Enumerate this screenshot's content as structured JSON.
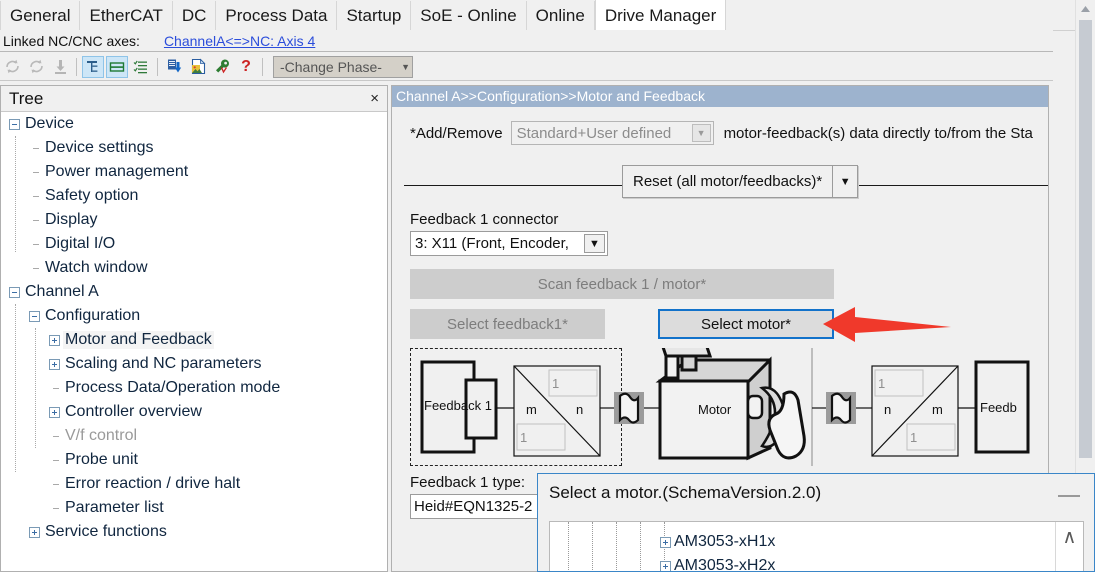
{
  "tabs": [
    {
      "label": "General",
      "active": false
    },
    {
      "label": "EtherCAT",
      "active": false
    },
    {
      "label": "DC",
      "active": false
    },
    {
      "label": "Process Data",
      "active": false
    },
    {
      "label": "Startup",
      "active": false
    },
    {
      "label": "SoE - Online",
      "active": false
    },
    {
      "label": "Online",
      "active": false
    },
    {
      "label": "Drive Manager",
      "active": true
    }
  ],
  "linked_bar": {
    "label": "Linked NC/CNC axes:",
    "link": "ChannelA<=>NC: Axis 4"
  },
  "toolbar": {
    "items": [
      {
        "name": "refresh-disabled-icon",
        "state": "disabled"
      },
      {
        "name": "reload-disabled-icon",
        "state": "disabled"
      },
      {
        "name": "download-disabled-icon",
        "state": "disabled"
      },
      {
        "name": "tree-view-icon",
        "state": "toggled-on"
      },
      {
        "name": "split-view-icon",
        "state": "toggled-on"
      },
      {
        "name": "list-view-icon",
        "state": "normal"
      },
      {
        "name": "save-to-device-icon",
        "state": "normal"
      },
      {
        "name": "export-icon",
        "state": "normal"
      },
      {
        "name": "wrench-icon",
        "state": "normal"
      },
      {
        "name": "help-icon",
        "state": "normal"
      }
    ],
    "phase_combo": "-Change Phase-"
  },
  "tree": {
    "title": "Tree",
    "close_label": "×",
    "nodes": [
      {
        "label": "Device",
        "depth": 0,
        "toggle": "minus",
        "dim": false,
        "selected": false
      },
      {
        "label": "Device settings",
        "depth": 1,
        "toggle": "leaf",
        "dim": false,
        "selected": false
      },
      {
        "label": "Power management",
        "depth": 1,
        "toggle": "leaf",
        "dim": false,
        "selected": false
      },
      {
        "label": "Safety option",
        "depth": 1,
        "toggle": "leaf",
        "dim": false,
        "selected": false
      },
      {
        "label": "Display",
        "depth": 1,
        "toggle": "leaf",
        "dim": false,
        "selected": false
      },
      {
        "label": "Digital I/O",
        "depth": 1,
        "toggle": "leaf",
        "dim": false,
        "selected": false
      },
      {
        "label": "Watch window",
        "depth": 1,
        "toggle": "leaf",
        "dim": false,
        "selected": false
      },
      {
        "label": "Channel A",
        "depth": 0,
        "toggle": "minus",
        "dim": false,
        "selected": false
      },
      {
        "label": "Configuration",
        "depth": 1,
        "toggle": "minus",
        "dim": false,
        "selected": false
      },
      {
        "label": "Motor and Feedback",
        "depth": 2,
        "toggle": "plus",
        "dim": false,
        "selected": true
      },
      {
        "label": "Scaling and NC parameters",
        "depth": 2,
        "toggle": "plus",
        "dim": false,
        "selected": false
      },
      {
        "label": "Process Data/Operation mode",
        "depth": 2,
        "toggle": "leaf",
        "dim": false,
        "selected": false
      },
      {
        "label": "Controller overview",
        "depth": 2,
        "toggle": "plus",
        "dim": false,
        "selected": false
      },
      {
        "label": "V/f control",
        "depth": 2,
        "toggle": "leaf",
        "dim": true,
        "selected": false
      },
      {
        "label": "Probe unit",
        "depth": 2,
        "toggle": "leaf",
        "dim": false,
        "selected": false
      },
      {
        "label": "Error reaction / drive halt",
        "depth": 2,
        "toggle": "leaf",
        "dim": false,
        "selected": false
      },
      {
        "label": "Parameter list",
        "depth": 2,
        "toggle": "leaf",
        "dim": false,
        "selected": false
      },
      {
        "label": "Service functions",
        "depth": 1,
        "toggle": "plus",
        "dim": false,
        "selected": false
      }
    ]
  },
  "content": {
    "breadcrumb": "Channel A>>Configuration>>Motor and Feedback",
    "add_remove": {
      "label": "*Add/Remove",
      "combo_value": "Standard+User defined",
      "tail_text": "motor-feedback(s) data directly to/from the Sta"
    },
    "reset_button": {
      "label": "Reset (all motor/feedbacks)*",
      "arrow": "▼"
    },
    "feedback1_connector": {
      "label": "Feedback 1 connector",
      "value": "3: X11 (Front, Encoder,"
    },
    "scan_button": "Scan feedback 1 / motor*",
    "select_feedback_button": "Select feedback1*",
    "select_motor_button": "Select motor*",
    "schematic": {
      "feedback1_label": "Feedback 1",
      "ratio_left_num": "1",
      "ratio_left_m": "m",
      "ratio_left_n": "n",
      "ratio_left_den": "1",
      "motor_label": "Motor",
      "ratio_right_num": "1",
      "ratio_right_n": "n",
      "ratio_right_m": "m",
      "ratio_right_den": "1",
      "feedback2_label": "Feedb"
    },
    "feedback1_type": {
      "label": "Feedback 1 type:",
      "value": "Heid#EQN1325-2"
    }
  },
  "dialog": {
    "title": "Select a motor.(SchemaVersion.2.0)",
    "minimize_label": "—",
    "items": [
      {
        "label": "AM3053-xH1x",
        "toggle": "plus"
      },
      {
        "label": "AM3053-xH2x",
        "toggle": "plus"
      }
    ],
    "scroll_up_glyph": "∧"
  },
  "colors": {
    "accent_blue": "#1272ca",
    "breadcrumb_bg": "#9db3ce",
    "arrow_red": "#f0392b",
    "link_blue": "#2b4ddb"
  }
}
